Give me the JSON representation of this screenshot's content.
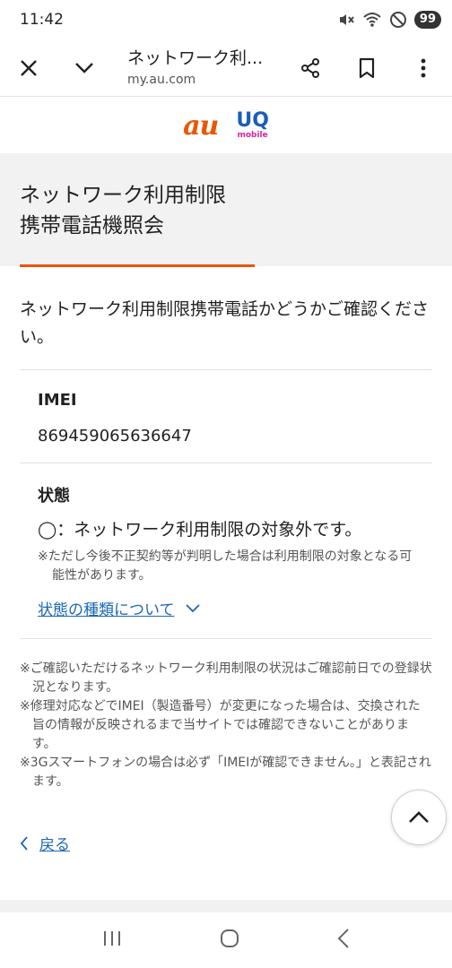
{
  "status_bar": {
    "time": "11:42",
    "battery": "99"
  },
  "browser": {
    "title": "ネットワーク利...",
    "url": "my.au.com"
  },
  "logos": {
    "au": "au",
    "uq_main": "UQ",
    "uq_sub": "mobile"
  },
  "page": {
    "title_line1": "ネットワーク利用制限",
    "title_line2": "携帯電話機照会",
    "intro": "ネットワーク利用制限携帯電話かどうかご確認ください。"
  },
  "imei": {
    "label": "IMEI",
    "value": "869459065636647"
  },
  "status": {
    "label": "状態",
    "result": "◯：ネットワーク利用制限の対象外です。",
    "note": "※ただし今後不正契約等が判明した場合は利用制限の対象となる可能性があります。",
    "link": "状態の種類について"
  },
  "notes": [
    "※ご確認いただけるネットワーク利用制限の状況はご確認前日での登録状況となります。",
    "※修理対応などでIMEI（製造番号）が変更になった場合は、交換された旨の情報が反映されるまで当サイトでは確認できないことがあります。",
    "※3Gスマートフォンの場合は必ず「IMEIが確認できません。」と表記されます。"
  ],
  "back": {
    "label": "戻る"
  },
  "colors": {
    "accent": "#eb5505",
    "link": "#1a67b8",
    "uq_blue": "#1a5db5",
    "uq_pink": "#d6249f"
  },
  "icons": [
    "mute-icon",
    "wifi-icon",
    "no-disturb-icon",
    "close-icon",
    "chevron-down-icon",
    "share-icon",
    "bookmark-icon",
    "more-vert-icon",
    "chevron-up-icon",
    "chevron-left-icon",
    "recents-icon",
    "home-icon",
    "back-icon"
  ]
}
